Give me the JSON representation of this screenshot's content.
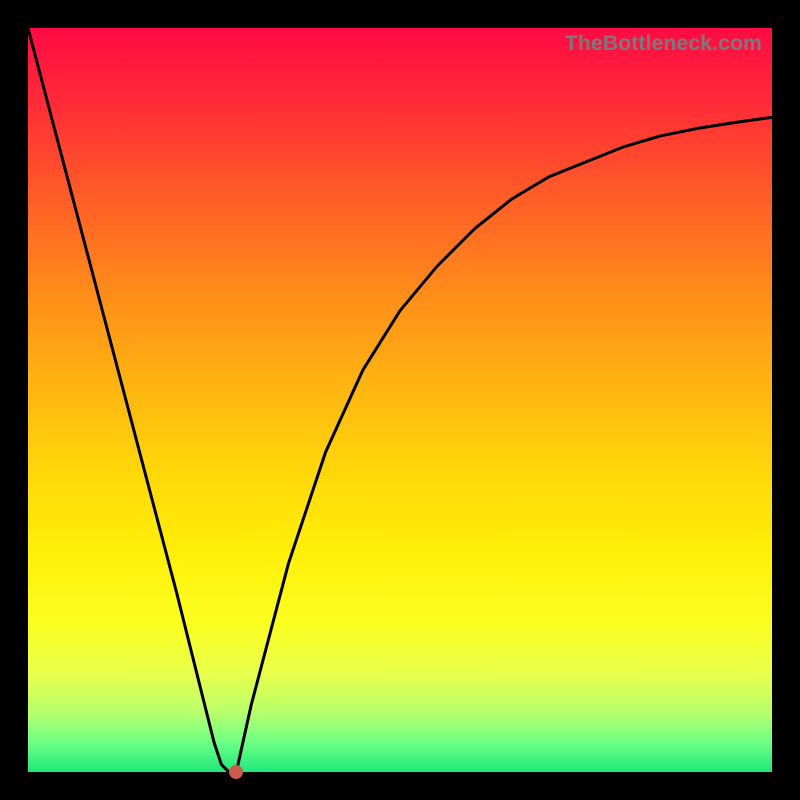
{
  "watermark": "TheBottleneck.com",
  "colors": {
    "curve": "#000000",
    "marker": "#cc5a4f",
    "frame": "#000000"
  },
  "chart_data": {
    "type": "line",
    "title": "",
    "xlabel": "",
    "ylabel": "",
    "xlim": [
      0,
      100
    ],
    "ylim": [
      0,
      100
    ],
    "grid": false,
    "series": [
      {
        "name": "bottleneck-curve",
        "x": [
          0,
          5,
          10,
          15,
          20,
          25,
          26,
          27,
          28,
          30,
          35,
          40,
          45,
          50,
          55,
          60,
          65,
          70,
          75,
          80,
          85,
          90,
          95,
          100
        ],
        "values": [
          100,
          81,
          62,
          43,
          24,
          4,
          1,
          0,
          0,
          9,
          28,
          43,
          54,
          62,
          68,
          73,
          77,
          80,
          82,
          84,
          85.5,
          86.5,
          87.3,
          88
        ]
      }
    ],
    "marker": {
      "x": 28,
      "y": 0
    },
    "annotations": []
  }
}
